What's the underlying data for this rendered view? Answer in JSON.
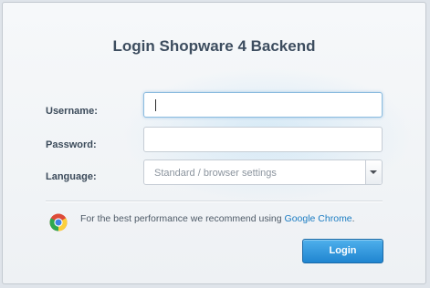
{
  "title": "Login Shopware 4 Backend",
  "form": {
    "username_label": "Username:",
    "username_value": "",
    "password_label": "Password:",
    "password_value": "",
    "language_label": "Language:",
    "language_value": "Standard / browser settings"
  },
  "notice": {
    "text": "For the best performance we recommend using ",
    "link_text": "Google Chrome",
    "suffix": "."
  },
  "login_button": "Login",
  "icons": {
    "browser": "chrome-icon",
    "dropdown": "chevron-down-icon"
  },
  "colors": {
    "accent": "#1f85d0",
    "link": "#1b7cc2",
    "title": "#3d4d5f"
  }
}
